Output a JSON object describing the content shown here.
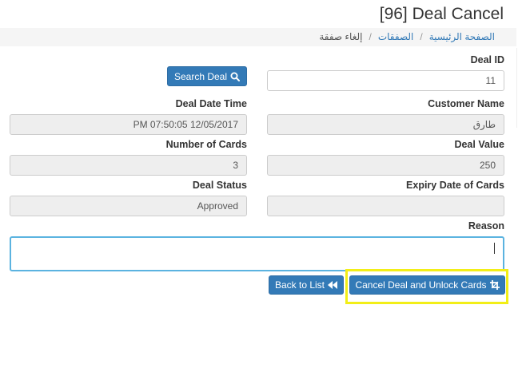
{
  "header": {
    "title": "[96] Deal Cancel"
  },
  "breadcrumb": {
    "home": "الصفحة الرئيسية",
    "deals": "الصفقات",
    "current": "إلغاء صفقة"
  },
  "form": {
    "deal_id": {
      "label": "Deal ID",
      "value": "11"
    },
    "customer_name": {
      "label": "Customer Name",
      "value": "طارق"
    },
    "deal_date_time": {
      "label": "Deal Date Time",
      "value": "PM 07:50:05 12/05/2017"
    },
    "deal_value": {
      "label": "Deal Value",
      "value": "250"
    },
    "number_of_cards": {
      "label": "Number of Cards",
      "value": "3"
    },
    "expiry_date_of_cards": {
      "label": "Expiry Date of Cards",
      "value": ""
    },
    "deal_status": {
      "label": "Deal Status",
      "value": "Approved"
    },
    "reason": {
      "label": "Reason",
      "value": ""
    }
  },
  "buttons": {
    "search_deal": "Search Deal",
    "back_to_list": "Back to List",
    "cancel_deal": "Cancel Deal and Unlock Cards"
  },
  "icons": {
    "search": "search-icon",
    "back": "backward-icon",
    "unlock": "crop-icon"
  },
  "colors": {
    "primary": "#337ab7",
    "highlight": "#f2ee17",
    "focus_border": "#5bb3e0",
    "readonly_bg": "#eeeeee"
  }
}
